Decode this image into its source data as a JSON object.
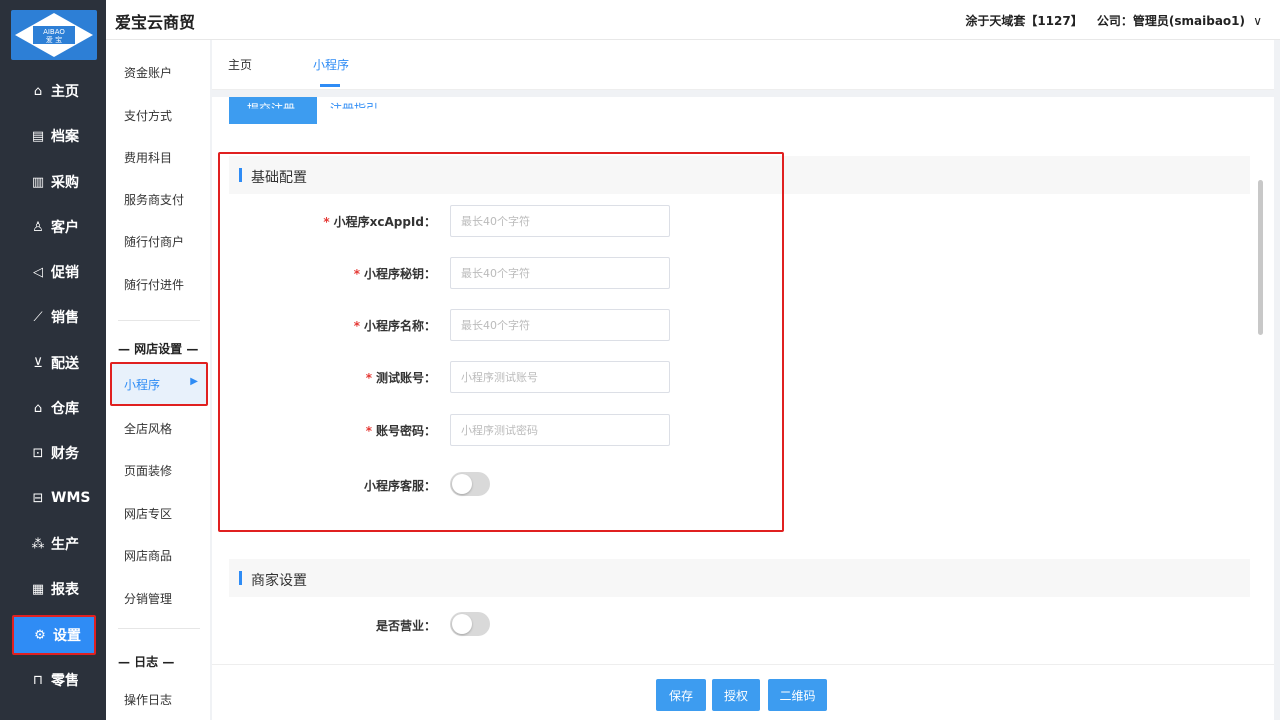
{
  "app": {
    "title": "爱宝云商贸",
    "logo_text_top": "AIBAO",
    "logo_text_bottom": "爱 宝"
  },
  "header": {
    "store": "涂于天域套【1127】",
    "company": "公司：管理员(smaibao1)",
    "chevron": "∨"
  },
  "nav": {
    "items": [
      {
        "label": "主页",
        "icon": "home-icon"
      },
      {
        "label": "档案",
        "icon": "archive-icon"
      },
      {
        "label": "采购",
        "icon": "purchase-icon"
      },
      {
        "label": "客户",
        "icon": "user-icon"
      },
      {
        "label": "促销",
        "icon": "megaphone-icon"
      },
      {
        "label": "销售",
        "icon": "chart-line-icon"
      },
      {
        "label": "配送",
        "icon": "cart-icon"
      },
      {
        "label": "仓库",
        "icon": "warehouse-icon"
      },
      {
        "label": "财务",
        "icon": "finance-icon"
      },
      {
        "label": "WMS",
        "icon": "truck-icon"
      },
      {
        "label": "生产",
        "icon": "production-icon"
      },
      {
        "label": "报表",
        "icon": "report-icon"
      },
      {
        "label": "设置",
        "icon": "gear-icon"
      },
      {
        "label": "零售",
        "icon": "bag-icon"
      }
    ],
    "active": "设置"
  },
  "submenu": {
    "items_top": [
      "资金账户",
      "支付方式",
      "费用科目",
      "服务商支付",
      "随行付商户",
      "随行付进件"
    ],
    "group_shop": "— 网店设置 —",
    "active_item": "小程序",
    "items_shop": [
      "全店风格",
      "页面装修",
      "网店专区",
      "网店商品",
      "分销管理"
    ],
    "group_log": "— 日志 —",
    "items_log": [
      "操作日志"
    ]
  },
  "tabs": [
    {
      "label": "主页",
      "active": false
    },
    {
      "label": "小程序",
      "active": true
    }
  ],
  "top_partial": {
    "button": "提交注册",
    "link": "注册指引"
  },
  "basic": {
    "title": "基础配置",
    "fields": [
      {
        "label": "小程序xcAppId：",
        "required": true,
        "placeholder": "最长40个字符",
        "value": ""
      },
      {
        "label": "小程序秘钥：",
        "required": true,
        "placeholder": "最长40个字符",
        "value": ""
      },
      {
        "label": "小程序名称：",
        "required": true,
        "placeholder": "最长40个字符",
        "value": ""
      },
      {
        "label": "测试账号：",
        "required": true,
        "placeholder": "小程序测试账号",
        "value": ""
      },
      {
        "label": "账号密码：",
        "required": true,
        "placeholder": "小程序测试密码",
        "value": ""
      }
    ],
    "toggle_label": "小程序客服：",
    "toggle_on": false
  },
  "merchant": {
    "title": "商家设置",
    "toggle_label": "是否营业：",
    "toggle_on": false
  },
  "footer": {
    "save": "保存",
    "authorize": "授权",
    "qrcode": "二维码"
  },
  "colors": {
    "accent": "#2f8cf5",
    "nav_bg": "#2b313b",
    "highlight": "#e02020",
    "required": "#e53935"
  }
}
